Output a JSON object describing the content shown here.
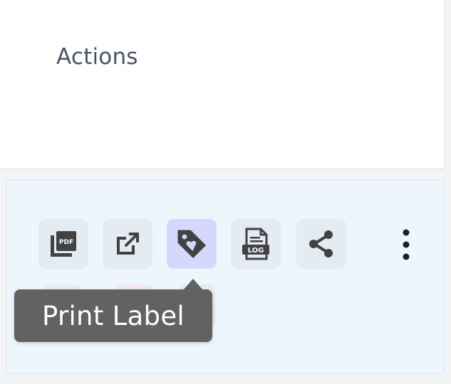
{
  "header": {
    "title": "Actions"
  },
  "toolbar": {
    "buttons": [
      {
        "id": "pdf",
        "icon": "pdf-icon",
        "badge": "PDF"
      },
      {
        "id": "open",
        "icon": "open-external-icon"
      },
      {
        "id": "label",
        "icon": "tag-heart-icon",
        "active": true
      },
      {
        "id": "log",
        "icon": "log-file-icon",
        "badge": "LOG"
      },
      {
        "id": "share",
        "icon": "share-icon"
      }
    ],
    "more_icon": "more-vertical-icon"
  },
  "tooltip": {
    "text": "Print Label"
  },
  "colors": {
    "icon": "#424242",
    "active_bg": "#d6d8fb",
    "active_icon": "#4b4fd1",
    "row_bg": "#edf5fd",
    "tooltip_bg": "#626262"
  }
}
